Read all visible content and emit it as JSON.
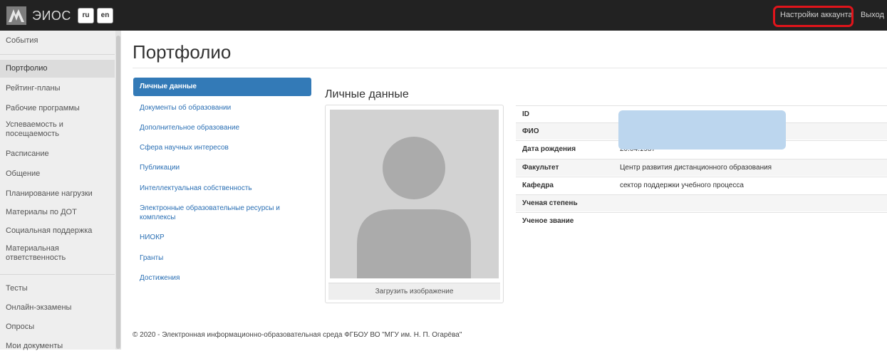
{
  "navbar": {
    "brand": "ЭИОС",
    "lang_ru": "ru",
    "lang_en": "en",
    "account_settings": "Настройки аккаунта",
    "logout": "Выход",
    "highlight_color": "#e0141b",
    "background": "#222222"
  },
  "sidebar": {
    "items": [
      {
        "label": "События"
      },
      {
        "label": "Портфолио"
      },
      {
        "label": "Рейтинг-планы"
      },
      {
        "label": "Рабочие программы"
      },
      {
        "label": "Успеваемость и посещаемость"
      },
      {
        "label": "Расписание"
      },
      {
        "label": "Общение"
      },
      {
        "label": "Планирование нагрузки"
      },
      {
        "label": "Материалы по ДОТ"
      },
      {
        "label": "Социальная поддержка"
      },
      {
        "label": "Материальная ответственность"
      },
      {
        "label": "Тесты"
      },
      {
        "label": "Онлайн-экзамены"
      },
      {
        "label": "Опросы"
      },
      {
        "label": "Мои документы"
      }
    ],
    "active": "Портфолио"
  },
  "main": {
    "title": "Портфолио",
    "portfolio_nav": [
      {
        "label": "Личные данные"
      },
      {
        "label": "Документы об образовании"
      },
      {
        "label": "Дополнительное образование"
      },
      {
        "label": "Сфера научных интересов"
      },
      {
        "label": "Публикации"
      },
      {
        "label": "Интеллектуальная собственность"
      },
      {
        "label": "Электронные образовательные ресурсы и комплексы"
      },
      {
        "label": "НИОКР"
      },
      {
        "label": "Гранты"
      },
      {
        "label": "Достижения"
      }
    ],
    "section_title": "Личные данные",
    "upload_button": "Загрузить изображение",
    "info_rows": [
      {
        "label": "ID",
        "value": ""
      },
      {
        "label": "ФИО",
        "value": ""
      },
      {
        "label": "Дата рождения",
        "value": "20.04.1987"
      },
      {
        "label": "Факультет",
        "value": "Центр развития дистанционного образования"
      },
      {
        "label": "Кафедра",
        "value": "сектор поддержки учебного процесса"
      },
      {
        "label": "Ученая степень",
        "value": ""
      },
      {
        "label": "Ученое звание",
        "value": ""
      }
    ],
    "accent_color": "#337ab7"
  },
  "footer": {
    "text": "© 2020 - Электронная информационно-образовательная среда ФГБОУ ВО \"МГУ им. Н. П. Огарёва\""
  }
}
